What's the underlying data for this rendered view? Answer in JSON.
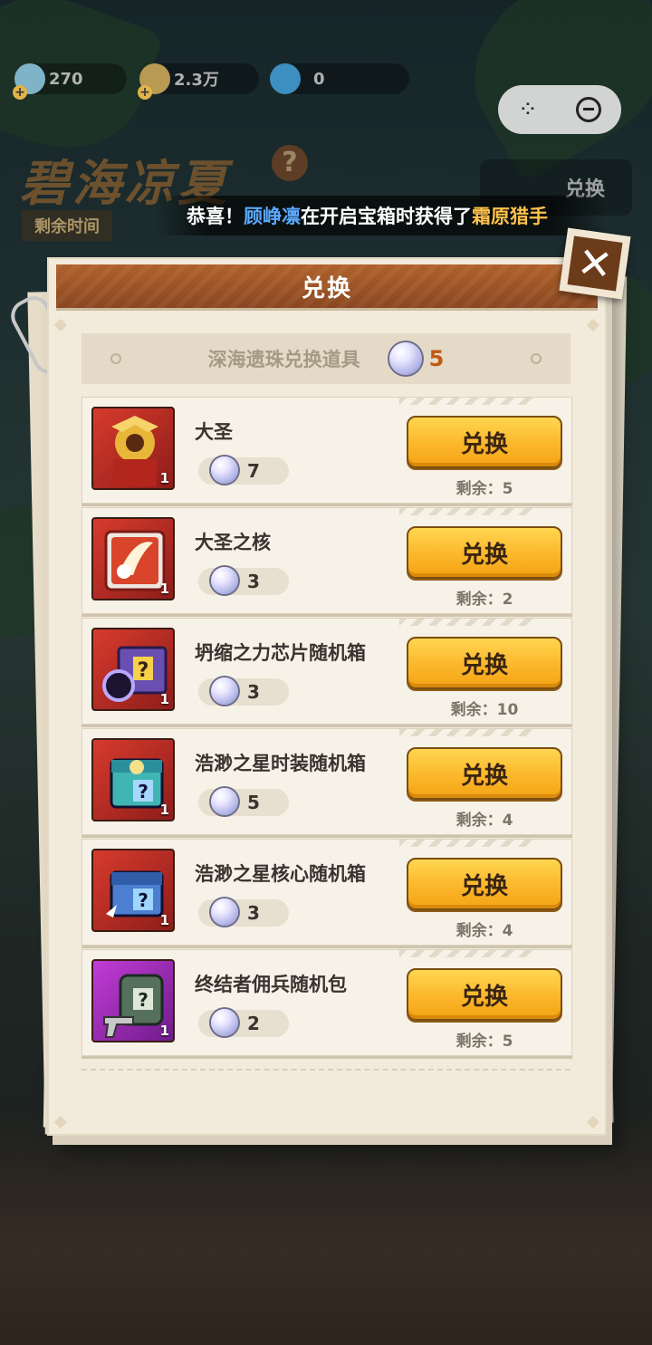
{
  "top_bar": {
    "gems": "270",
    "currency": "2.3万",
    "shovel": "0"
  },
  "event": {
    "title": "碧海凉夏",
    "help": "?",
    "time_label": "剩余时间",
    "exchange_label": "兑换"
  },
  "marquee": {
    "prefix": "恭喜！",
    "player": "顾峥凛",
    "middle": "在开启宝箱时获得了",
    "item": "霜原猎手"
  },
  "dialog": {
    "title": "兑换",
    "subtitle": "深海遗珠兑换道具",
    "pearl_count": "5",
    "button_label": "兑换",
    "close_label": "✕"
  },
  "items": [
    {
      "name": "大圣",
      "cost": "7",
      "remain": "剩余：5",
      "qty": "1",
      "frame": "red",
      "icon": "monkey-king-icon"
    },
    {
      "name": "大圣之核",
      "cost": "3",
      "remain": "剩余：2",
      "qty": "1",
      "frame": "red",
      "icon": "core-chip-icon"
    },
    {
      "name": "坍缩之力芯片随机箱",
      "cost": "3",
      "remain": "剩余：10",
      "qty": "1",
      "frame": "red",
      "icon": "mystery-box-icon"
    },
    {
      "name": "浩渺之星时装随机箱",
      "cost": "5",
      "remain": "剩余：4",
      "qty": "1",
      "frame": "red",
      "icon": "costume-box-icon"
    },
    {
      "name": "浩渺之星核心随机箱",
      "cost": "3",
      "remain": "剩余：4",
      "qty": "1",
      "frame": "red",
      "icon": "core-box-icon"
    },
    {
      "name": "终结者佣兵随机包",
      "cost": "2",
      "remain": "剩余：5",
      "qty": "1",
      "frame": "purple",
      "icon": "mercenary-pack-icon"
    }
  ],
  "colors": {
    "header": "#8a4720",
    "button": "#fbb72a",
    "pearl_count": "#c05a12",
    "player_name": "#5aa9ff",
    "item_highlight": "#ffc24a"
  }
}
